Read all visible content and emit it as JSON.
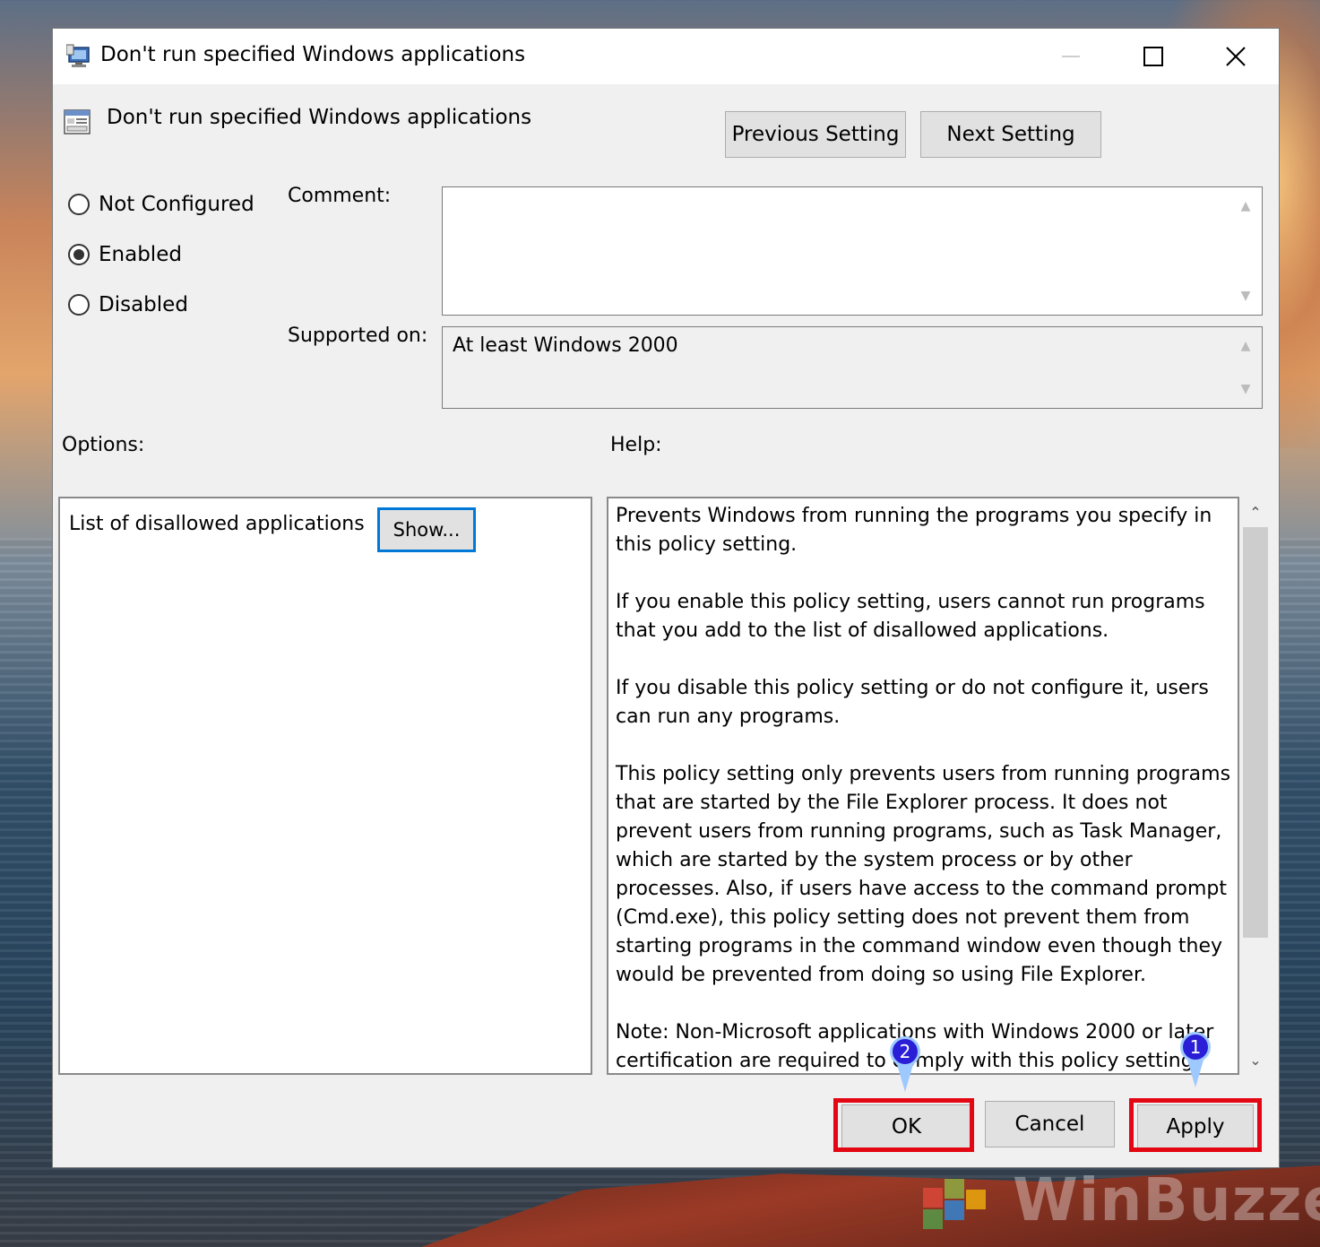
{
  "window": {
    "title": "Don't run specified Windows applications"
  },
  "policy": {
    "title": "Don't run specified Windows applications"
  },
  "nav": {
    "previous_label": "Previous Setting",
    "next_label": "Next Setting"
  },
  "state_options": [
    {
      "label": "Not Configured",
      "selected": false
    },
    {
      "label": "Enabled",
      "selected": true
    },
    {
      "label": "Disabled",
      "selected": false
    }
  ],
  "comment": {
    "label": "Comment:",
    "value": ""
  },
  "supported": {
    "label": "Supported on:",
    "value": "At least Windows 2000"
  },
  "options": {
    "label": "Options:",
    "item_label": "List of disallowed applications",
    "show_label": "Show..."
  },
  "help": {
    "label": "Help:",
    "paragraphs": [
      "Prevents Windows from running the programs you specify in this policy setting.",
      "If you enable this policy setting, users cannot run programs that you add to the list of disallowed applications.",
      "If you disable this policy setting or do not configure it, users can run any programs.",
      "This policy setting only prevents users from running programs that are started by the File Explorer process. It does not prevent users from running programs, such as Task Manager, which are started by the system process or by other processes.  Also, if users have access to the command prompt (Cmd.exe), this policy setting does not prevent them from starting programs in the command window even though they would be prevented from doing so using File Explorer.",
      "Note: Non-Microsoft applications with Windows 2000 or later certification are required to comply with this policy setting."
    ]
  },
  "footer": {
    "ok_label": "OK",
    "cancel_label": "Cancel",
    "apply_label": "Apply"
  },
  "annotations": {
    "apply_step": "1",
    "ok_step": "2",
    "highlight_color": "#e30613",
    "marker_color": "#2a1fd6"
  },
  "watermark": {
    "text": "WinBuzzer"
  }
}
